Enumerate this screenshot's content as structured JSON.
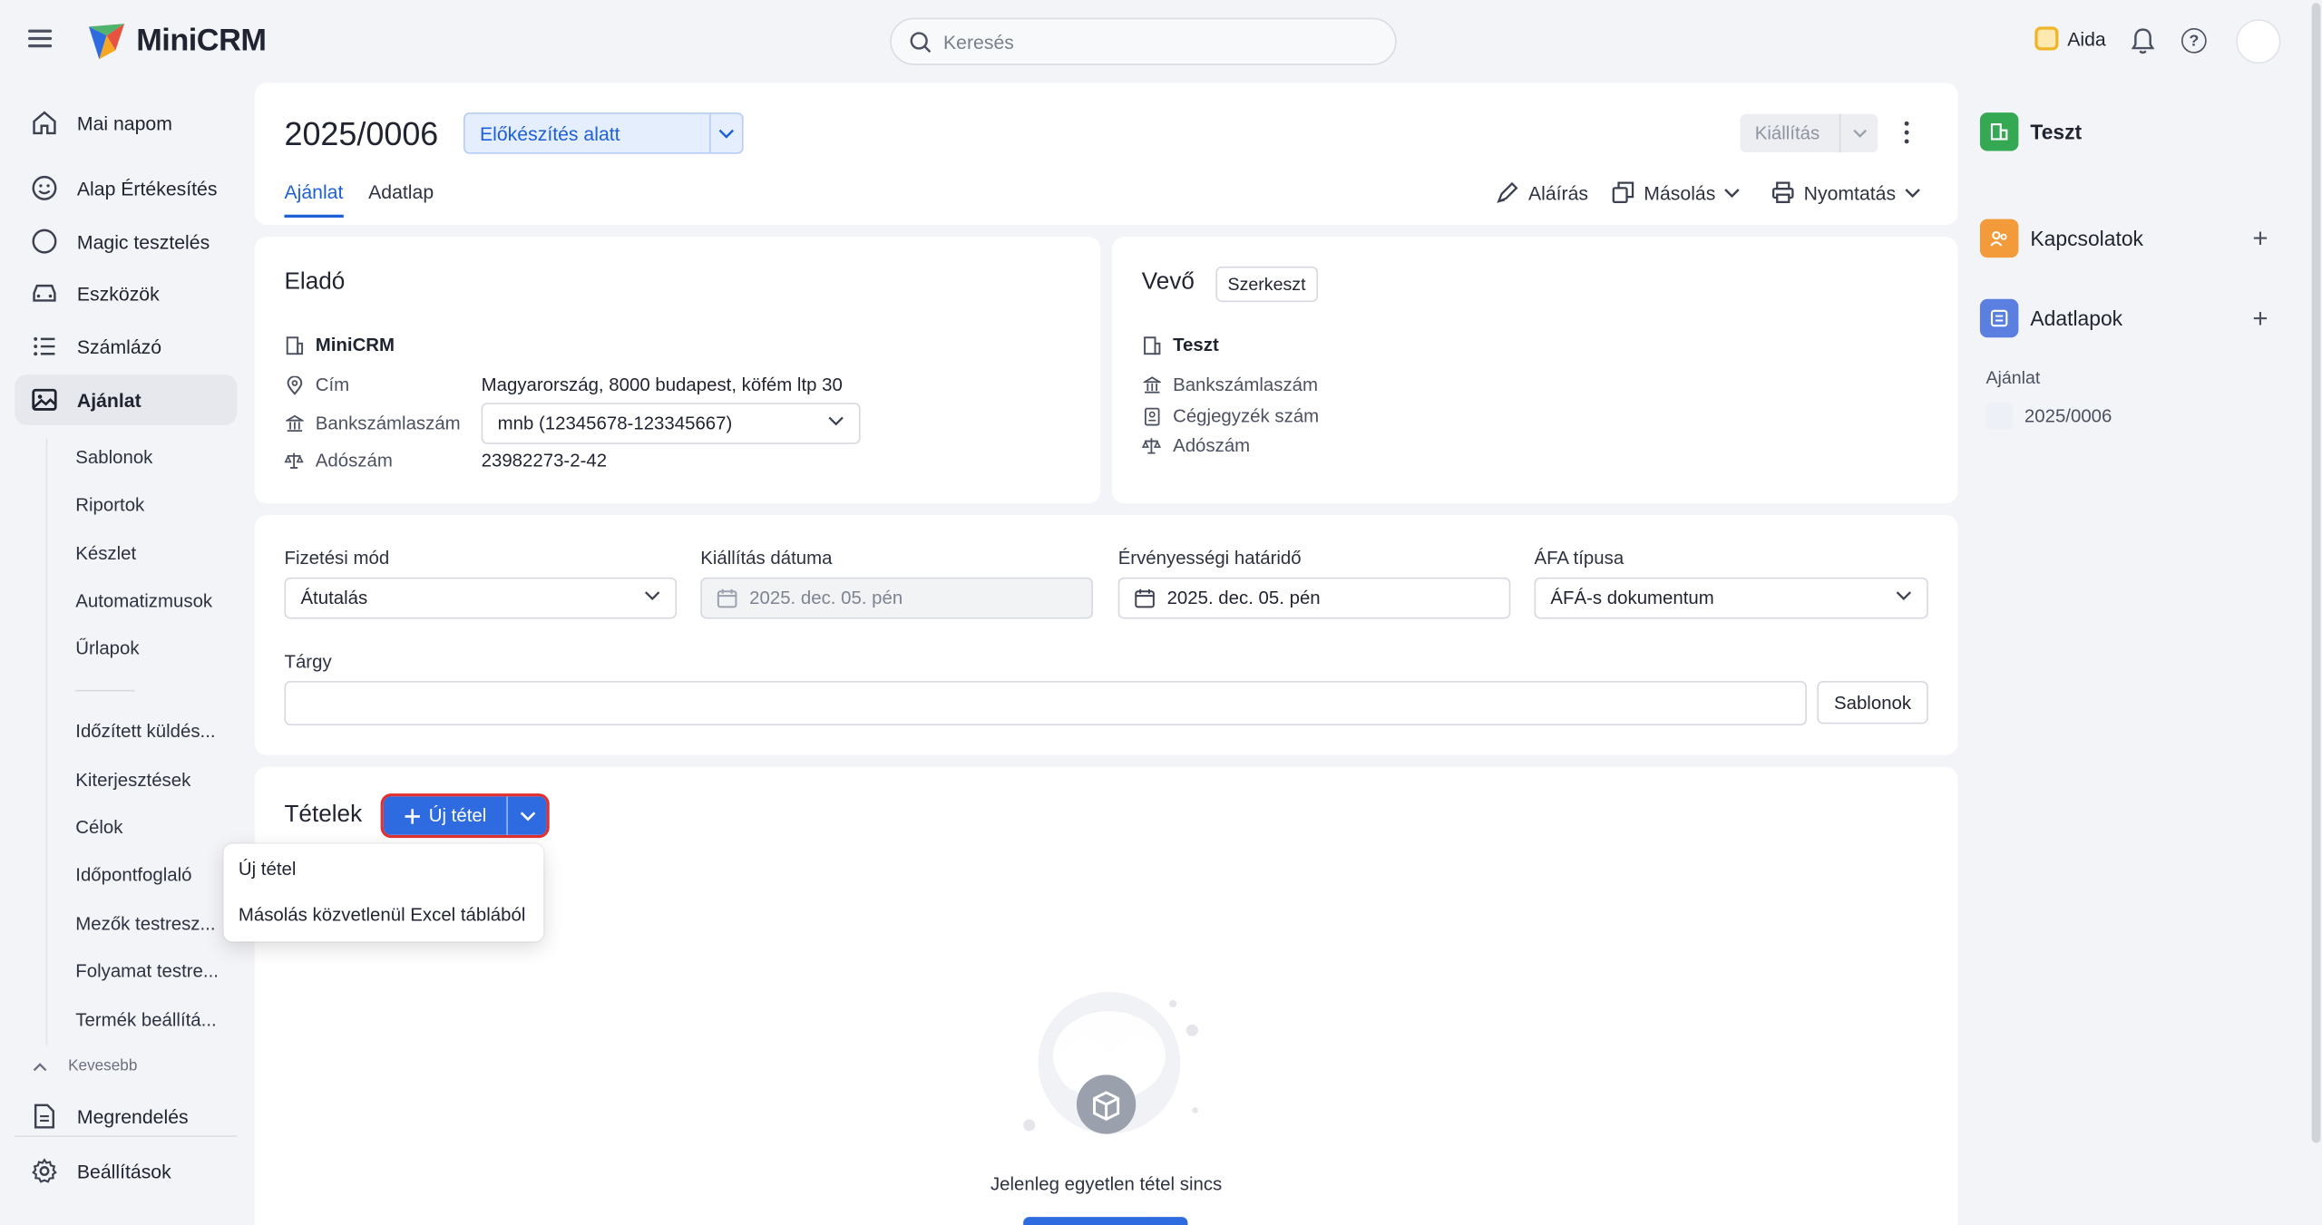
{
  "app": {
    "name": "MiniCRM"
  },
  "search": {
    "placeholder": "Keresés"
  },
  "topbar": {
    "assistant_label": "Aida"
  },
  "sidebar": {
    "items": [
      {
        "label": "Mai napom",
        "icon": "home-icon"
      },
      {
        "label": "Alap Értékesítés",
        "icon": "smiley-icon"
      },
      {
        "label": "Magic tesztelés",
        "icon": "circle-icon"
      },
      {
        "label": "Eszközök",
        "icon": "car-icon"
      },
      {
        "label": "Számlázó",
        "icon": "list-icon"
      },
      {
        "label": "Ajánlat",
        "icon": "image-icon",
        "active": true
      }
    ],
    "sub_items": [
      "Sablonok",
      "Riportok",
      "Készlet",
      "Automatizmusok",
      "Űrlapok",
      "Időzített küldés...",
      "Kiterjesztések",
      "Célok",
      "Időpontfoglaló",
      "Mezők testresz...",
      "Folyamat testre...",
      "Termék beállítá..."
    ],
    "collapse_label": "Kevesebb",
    "bottom_items": [
      {
        "label": "Megrendelés",
        "icon": "document-icon"
      },
      {
        "label": "Beállítások",
        "icon": "gear-icon"
      }
    ]
  },
  "header": {
    "doc_number": "2025/0006",
    "status": "Előkészítés alatt",
    "issue_button": "Kiállítás",
    "tabs": [
      {
        "label": "Ajánlat",
        "active": true
      },
      {
        "label": "Adatlap",
        "active": false
      }
    ],
    "actions": {
      "sign": "Aláírás",
      "copy": "Másolás",
      "print": "Nyomtatás"
    }
  },
  "seller": {
    "title": "Eladó",
    "company": "MiniCRM",
    "address_label": "Cím",
    "address": "Magyarország, 8000 budapest, köfém ltp 30",
    "bank_label": "Bankszámlaszám",
    "bank_value": "mnb (12345678-123345667)",
    "tax_label": "Adószám",
    "tax_value": "23982273-2-42"
  },
  "buyer": {
    "title": "Vevő",
    "edit_button": "Szerkeszt",
    "company": "Teszt",
    "bank_label": "Bankszámlaszám",
    "registry_label": "Cégjegyzék szám",
    "tax_label": "Adószám"
  },
  "form": {
    "payment_label": "Fizetési mód",
    "payment_value": "Átutalás",
    "issue_date_label": "Kiállítás dátuma",
    "issue_date_value": "2025. dec. 05. pén",
    "validity_label": "Érvényességi határidő",
    "validity_value": "2025. dec. 05. pén",
    "vat_label": "ÁFA típusa",
    "vat_value": "ÁFÁ-s dokumentum",
    "subject_label": "Tárgy",
    "subject_value": "",
    "templates_button": "Sablonok"
  },
  "items": {
    "title": "Tételek",
    "new_item_button": "Új tétel",
    "empty_text": "Jelenleg egyetlen tétel sincs"
  },
  "dropdown": {
    "options": [
      "Új tétel",
      "Másolás közvetlenül Excel táblából"
    ]
  },
  "right_panel": {
    "record": "Teszt",
    "relations": "Kapcsolatok",
    "datasheets": "Adatlapok",
    "sub_label": "Ajánlat",
    "sub_item": "2025/0006",
    "colors": {
      "record": "#34a853",
      "relations": "#f39a3b",
      "datasheets": "#5b7fe0"
    }
  },
  "colors": {
    "primary": "#2f6be0",
    "status_bg": "#e5eefc",
    "highlight": "#e03131"
  }
}
